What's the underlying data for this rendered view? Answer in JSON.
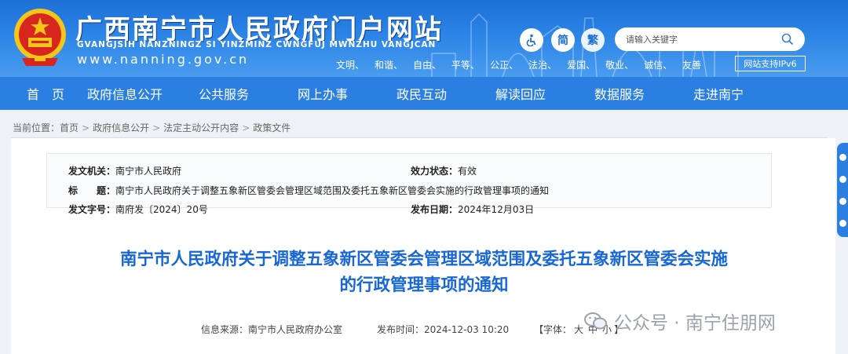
{
  "header": {
    "title": "广西南宁市人民政府门户网站",
    "subtitle": "GVANGJSIH NANZNINGZ SI YINZMINZ CWNGFUJ MWNZHU VANGJCAN",
    "url": "www.nanning.gov.cn",
    "simplified_label": "简",
    "traditional_label": "繁",
    "search_placeholder": "请输入关键字",
    "values": [
      "文明、",
      "和谐、",
      "自由、",
      "平等、",
      "公正、",
      "法治、",
      "爱国、",
      "敬业、",
      "诚信、",
      "友善"
    ],
    "ipv6_label": "网站支持IPv6"
  },
  "nav": {
    "items": [
      "首　页",
      "政府信息公开",
      "公共服务",
      "网上办事",
      "政民互动",
      "解读回应",
      "数据服务",
      "走进南宁"
    ]
  },
  "breadcrumb": {
    "prefix": "当前位置：",
    "items": [
      "首页",
      "政府信息公开",
      "法定主动公开内容",
      "政策文件"
    ],
    "separator": ">"
  },
  "meta": {
    "issuer_label": "发文机关：",
    "issuer": "南宁市人民政府",
    "status_label": "效力状态：",
    "status": "有效",
    "title_label": "标　　题：",
    "title": "南宁市人民政府关于调整五象新区管委会管理区域范围及委托五象新区管委会实施的行政管理事项的通知",
    "docno_label": "发文字号：",
    "docno": "南府发〔2024〕20号",
    "date_label": "发布日期：",
    "date": "2024年12月03日"
  },
  "document": {
    "title_line1": "南宁市人民政府关于调整五象新区管委会管理区域范围及委托五象新区管委会实施",
    "title_line2": "的行政管理事项的通知",
    "source": "信息来源：南宁市人民政府办公室",
    "publish_time": "发布时间：2024-12-03 10:20",
    "font_prefix": "【字体：",
    "font_large": "大",
    "font_medium": "中",
    "font_small": "小",
    "font_suffix": "】"
  },
  "watermark": {
    "text": "公众号 · 南宁住朋网"
  },
  "colors": {
    "header_blue": "#1d6fd6",
    "nav_blue": "#2b7fe0",
    "title_blue": "#1767d6"
  }
}
